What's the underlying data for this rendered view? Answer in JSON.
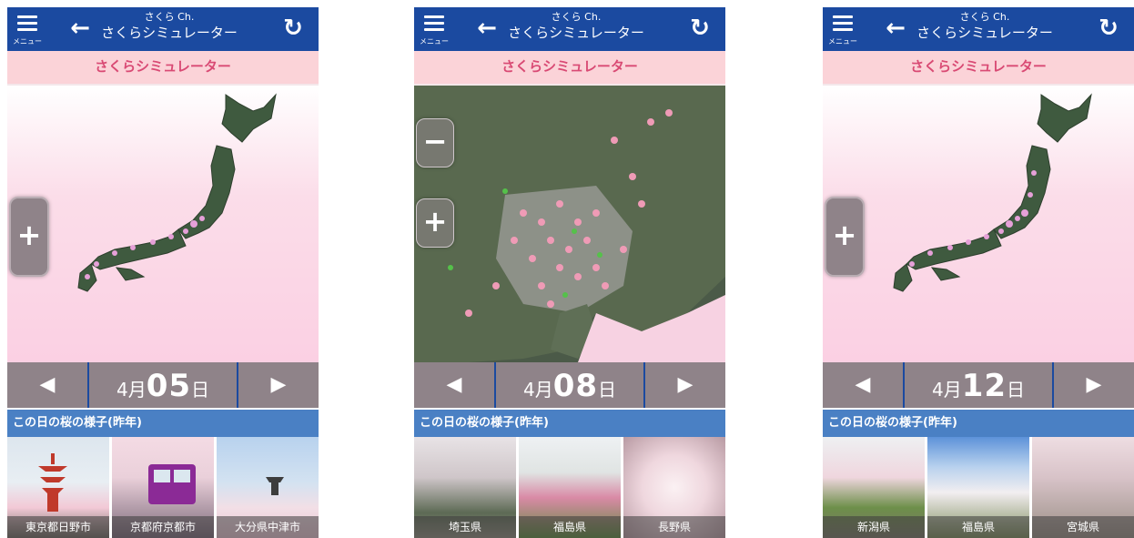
{
  "header": {
    "menu_label": "メニュー",
    "channel": "さくら Ch.",
    "title": "さくらシミュレーター"
  },
  "subheader": "さくらシミュレーター",
  "section_title": "この日の桜の様子(昨年)",
  "controls": {
    "prev": "◀",
    "next": "▶",
    "zoom_in": "+",
    "zoom_out": "−"
  },
  "screens": [
    {
      "month": "4月",
      "day": "05",
      "day_unit": "日",
      "photos": [
        "東京都日野市",
        "京都府京都市",
        "大分県中津市"
      ]
    },
    {
      "month": "4月",
      "day": "08",
      "day_unit": "日",
      "photos": [
        "埼玉県",
        "福島県",
        "長野県"
      ]
    },
    {
      "month": "4月",
      "day": "12",
      "day_unit": "日",
      "photos": [
        "新潟県",
        "福島県",
        "宮城県"
      ]
    }
  ],
  "colors": {
    "accent": "#1b4aa0",
    "pink": "#fbd3d8",
    "title_text": "#d94a74",
    "date_bar": "#8f8389",
    "section_bar": "#4a80c4"
  }
}
